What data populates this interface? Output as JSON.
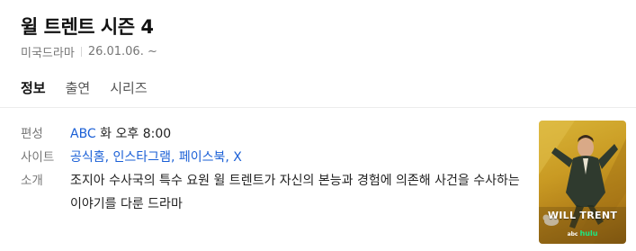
{
  "header": {
    "title": "윌 트렌트 시즌 4",
    "category": "미국드라마",
    "air_date": "26.01.06. ~"
  },
  "tabs": [
    {
      "label": "정보",
      "active": true
    },
    {
      "label": "출연",
      "active": false
    },
    {
      "label": "시리즈",
      "active": false
    }
  ],
  "info": {
    "broadcast": {
      "label": "편성",
      "channel": "ABC",
      "schedule": "화 오후 8:00"
    },
    "sites": {
      "label": "사이트",
      "links": [
        "공식홈",
        "인스타그램",
        "페이스북",
        "X"
      ]
    },
    "synopsis": {
      "label": "소개",
      "text": "조지아 수사국의 특수 요원 윌 트렌트가 자신의 본능과 경험에 의존해 사건을 수사하는 이야기를 다룬 드라마"
    }
  },
  "poster": {
    "title_text": "WILL TRENT",
    "network_text": "abc",
    "hulu_text": "hulu",
    "colors": {
      "background": "#c99a23",
      "jacket": "#2f3a2e"
    }
  }
}
